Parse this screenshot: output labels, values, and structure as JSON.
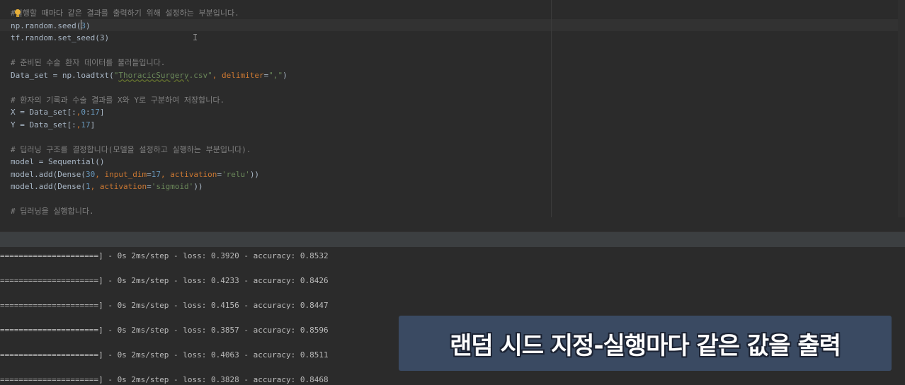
{
  "editor": {
    "lines": [
      {
        "parts": [
          {
            "t": "#",
            "c": "cm"
          },
          {
            "t": "실행할 때마다 같은 결과를 출력하기 위해 설정하는 부분입니다.",
            "c": "cm"
          }
        ]
      },
      {
        "parts": [
          {
            "t": "np.random.seed(",
            "c": ""
          },
          {
            "t": "3",
            "c": "num"
          },
          {
            "t": ")",
            "c": ""
          }
        ]
      },
      {
        "parts": [
          {
            "t": "tf.random.set_seed(3)",
            "c": ""
          }
        ]
      },
      {
        "parts": []
      },
      {
        "parts": [
          {
            "t": "# 준비된 수술 환자 데이터를 불러들입니다.",
            "c": "cm"
          }
        ]
      },
      {
        "parts": [
          {
            "t": "Data_set = np.loadtxt(",
            "c": ""
          },
          {
            "t": "\"",
            "c": "str"
          },
          {
            "t": "ThoracicSurgery",
            "c": "str wav"
          },
          {
            "t": ".csv\"",
            "c": "str"
          },
          {
            "t": ", ",
            "c": "kw"
          },
          {
            "t": "delimiter",
            "c": "kw"
          },
          {
            "t": "=",
            "c": ""
          },
          {
            "t": "\",\"",
            "c": "str"
          },
          {
            "t": ")",
            "c": ""
          }
        ]
      },
      {
        "parts": []
      },
      {
        "parts": [
          {
            "t": "# 환자의 기록과 수술 결과를 X와 Y로 구분하여 저장합니다.",
            "c": "cm"
          }
        ]
      },
      {
        "parts": [
          {
            "t": "X = Data_set[:",
            "c": ""
          },
          {
            "t": ",",
            "c": "kw"
          },
          {
            "t": "0",
            "c": "num"
          },
          {
            "t": ":",
            "c": ""
          },
          {
            "t": "17",
            "c": "num"
          },
          {
            "t": "]",
            "c": ""
          }
        ]
      },
      {
        "parts": [
          {
            "t": "Y = Data_set[:",
            "c": ""
          },
          {
            "t": ",",
            "c": "kw"
          },
          {
            "t": "17",
            "c": "num"
          },
          {
            "t": "]",
            "c": ""
          }
        ]
      },
      {
        "parts": []
      },
      {
        "parts": [
          {
            "t": "# 딥러닝 구조를 결정합니다(모델을 설정하고 실행하는 부분입니다).",
            "c": "cm"
          }
        ]
      },
      {
        "parts": [
          {
            "t": "model = Sequential()",
            "c": ""
          }
        ]
      },
      {
        "parts": [
          {
            "t": "model.add(Dense(",
            "c": ""
          },
          {
            "t": "30",
            "c": "num"
          },
          {
            "t": ", ",
            "c": "kw"
          },
          {
            "t": "input_dim",
            "c": "kw"
          },
          {
            "t": "=",
            "c": ""
          },
          {
            "t": "17",
            "c": "num"
          },
          {
            "t": ", ",
            "c": "kw"
          },
          {
            "t": "activation",
            "c": "kw"
          },
          {
            "t": "=",
            "c": ""
          },
          {
            "t": "'relu'",
            "c": "str"
          },
          {
            "t": "))",
            "c": ""
          }
        ]
      },
      {
        "parts": [
          {
            "t": "model.add(Dense(",
            "c": ""
          },
          {
            "t": "1",
            "c": "num"
          },
          {
            "t": ", ",
            "c": "kw"
          },
          {
            "t": "activation",
            "c": "kw"
          },
          {
            "t": "=",
            "c": ""
          },
          {
            "t": "'sigmoid'",
            "c": "str"
          },
          {
            "t": "))",
            "c": ""
          }
        ]
      },
      {
        "parts": []
      },
      {
        "parts": [
          {
            "t": "# 딥러닝을 실행합니다.",
            "c": "cm"
          }
        ]
      }
    ]
  },
  "console": {
    "lines": [
      "=====================] - 0s 2ms/step - loss: 0.3920 - accuracy: 0.8532",
      "=====================] - 0s 2ms/step - loss: 0.4233 - accuracy: 0.8426",
      "=====================] - 0s 2ms/step - loss: 0.4156 - accuracy: 0.8447",
      "=====================] - 0s 2ms/step - loss: 0.3857 - accuracy: 0.8596",
      "=====================] - 0s 2ms/step - loss: 0.4063 - accuracy: 0.8511",
      "=====================] - 0s 2ms/step - loss: 0.3828 - accuracy: 0.8468"
    ]
  },
  "caption": {
    "text": "랜덤 시드 지정-실행마다 같은 값을 출력"
  },
  "colors": {
    "comment": "#808080",
    "string": "#6a8759",
    "number": "#6897bb",
    "keyword": "#cc7832",
    "banner": "#3a4a62"
  },
  "icons": {
    "intention": "lightbulb-icon",
    "mouse": "text-cursor-icon"
  }
}
